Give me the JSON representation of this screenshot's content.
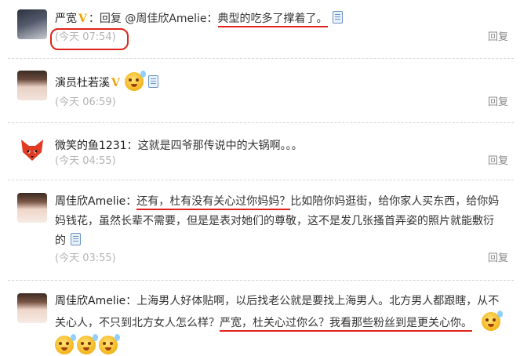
{
  "comments": [
    {
      "name": "严宽",
      "verified": "V",
      "text_prefix": "：回复 @周佳欣Amelie：",
      "text_highlight": "典型的吃多了撑着了。",
      "time": "(今天 07:54)",
      "reply": "回复"
    },
    {
      "name": "演员杜若溪",
      "verified": "V",
      "time": "(今天 06:59)",
      "reply": "回复"
    },
    {
      "name": "微笑的鱼1231",
      "text": "：这就是四爷那传说中的大锅啊。。。",
      "time": "(今天 04:55)",
      "reply": "回复"
    },
    {
      "name": "周佳欣Amelie",
      "line1_prefix": "：",
      "line1_highlight": "还有，杜有没有关心过你妈妈？",
      "line1_suffix": "比如陪你妈逛街，给你家人买东西，给你妈",
      "line2": "妈钱花，虽然长辈不需要，但是是表对她们的尊敬，这不是发几张搔首弄姿的照片就能敷衍",
      "line3": "的",
      "time": "(今天 03:55)",
      "reply": "回复"
    },
    {
      "name": "周佳欣Amelie",
      "line1": "：上海男人好体贴啊，以后找老公就是要找上海男人。北方男人都跟瞎，从不",
      "line2_prefix": "关心人，不只到北方女人怎么样？",
      "line2_highlight": "严宽，杜关心过你么？我看那些粉丝到是更关心你。",
      "reply": "回复"
    }
  ],
  "colors": {
    "highlight_red": "#e0231b",
    "time_gray": "#b3b3b3",
    "verified_gold": "#f0a000"
  },
  "icons": [
    "doc-icon",
    "sweat-face-emoticon",
    "verified-v-icon"
  ]
}
